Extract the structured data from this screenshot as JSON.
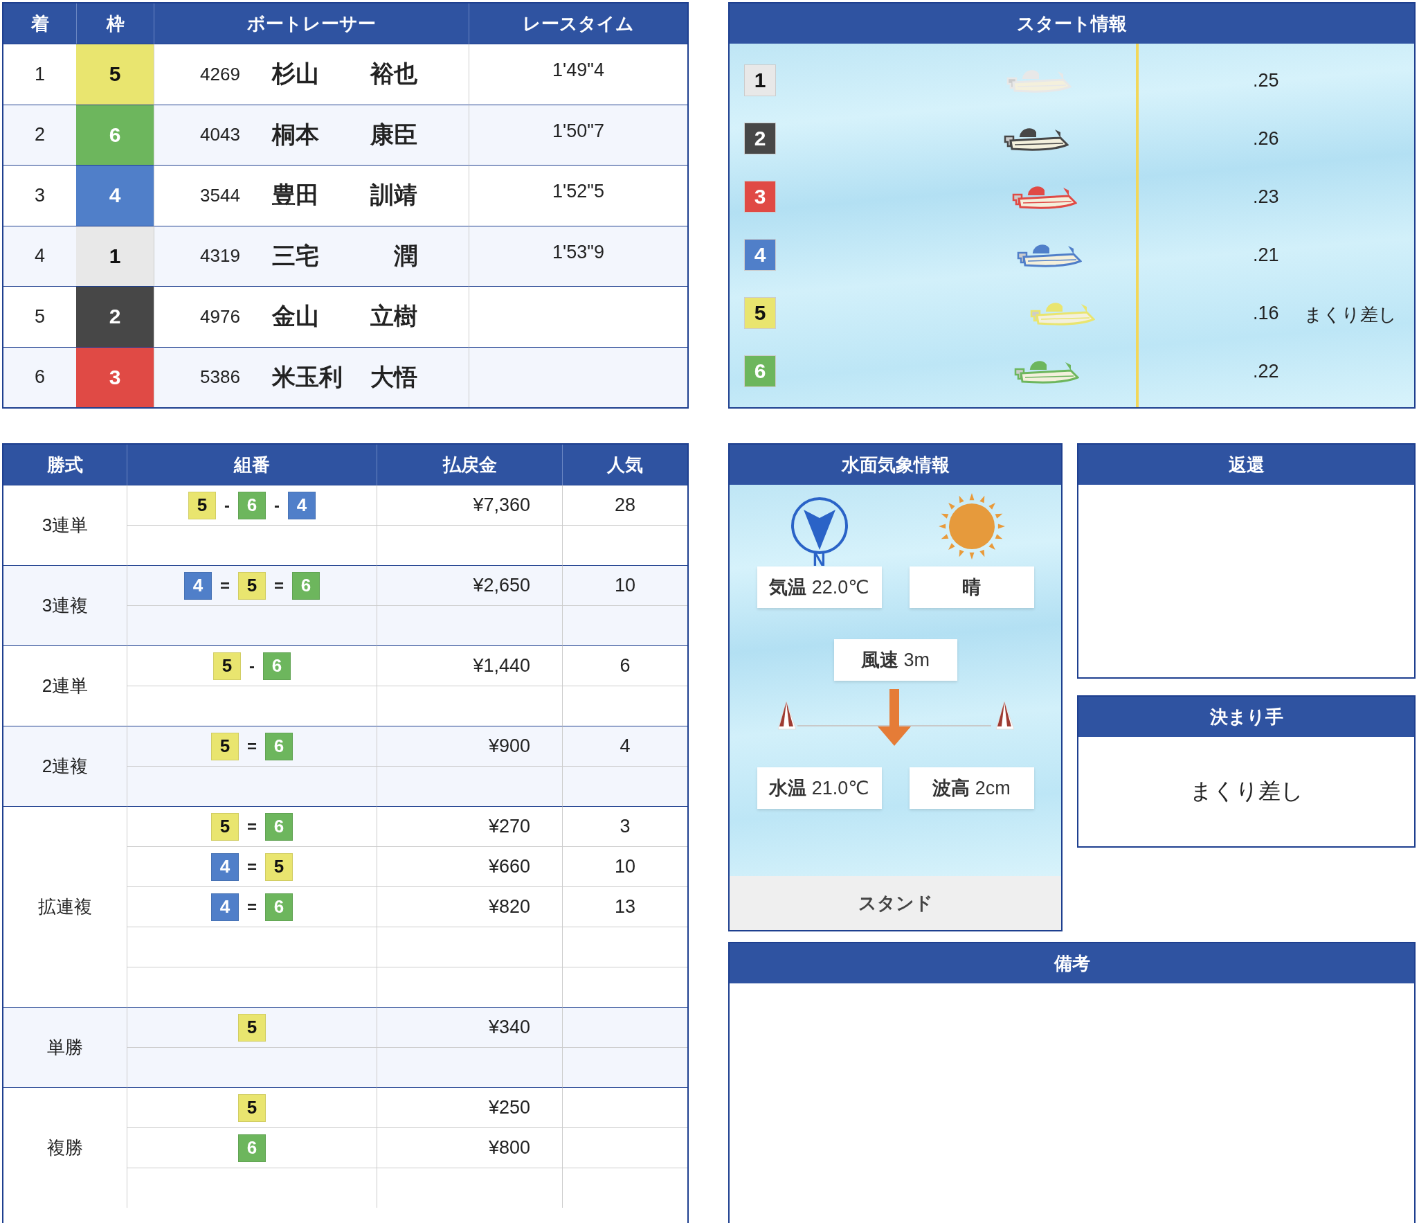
{
  "race_result": {
    "columns": [
      "着",
      "枠",
      "ボートレーサー",
      "レースタイム"
    ],
    "racers": [
      {
        "rank": "1",
        "frame": "5",
        "color": "#e9e56f",
        "reg_no": "4269",
        "surname": "杉山",
        "given_name": "裕也",
        "time": "1'49\"4"
      },
      {
        "rank": "2",
        "frame": "6",
        "color": "#6db65d",
        "reg_no": "4043",
        "surname": "桐本",
        "given_name": "康臣",
        "time": "1'50\"7"
      },
      {
        "rank": "3",
        "frame": "4",
        "color": "#507fc9",
        "reg_no": "3544",
        "surname": "豊田",
        "given_name": "訓靖",
        "time": "1'52\"5"
      },
      {
        "rank": "4",
        "frame": "1",
        "color": "#e8e8e8",
        "reg_no": "4319",
        "surname": "三宅",
        "given_name": "潤",
        "time": "1'53\"9"
      },
      {
        "rank": "5",
        "frame": "2",
        "color": "#474747",
        "reg_no": "4976",
        "surname": "金山",
        "given_name": "立樹"
      },
      {
        "rank": "6",
        "frame": "3",
        "color": "#e04a45",
        "reg_no": "5386",
        "surname": "米玉利",
        "given_name": "大悟"
      }
    ]
  },
  "start_info": {
    "title": "スタート情報",
    "entries": [
      {
        "frame": "1",
        "color": "#e8e8e8",
        "timing": ".25"
      },
      {
        "frame": "2",
        "color": "#474747",
        "timing": ".26"
      },
      {
        "frame": "3",
        "color": "#e04a45",
        "timing": ".23"
      },
      {
        "frame": "4",
        "color": "#507fc9",
        "timing": ".21"
      },
      {
        "frame": "5",
        "color": "#e9e56f",
        "timing": ".16",
        "technique": "まくり差し"
      },
      {
        "frame": "6",
        "color": "#6db65d",
        "timing": ".22"
      }
    ]
  },
  "payouts": {
    "columns": [
      "勝式",
      "組番",
      "払戻金",
      "人気"
    ],
    "groups": [
      {
        "bet_type": "3連単",
        "rows": [
          {
            "kind": "entry",
            "separator": "-",
            "combo": [
              {
                "num": "5",
                "color": "#e9e56f"
              },
              {
                "num": "6",
                "color": "#6db65d"
              },
              {
                "num": "4",
                "color": "#507fc9"
              }
            ],
            "payout": "¥7,360",
            "popularity": "28"
          },
          {
            "kind": "blank"
          }
        ]
      },
      {
        "bet_type": "3連複",
        "rows": [
          {
            "kind": "entry",
            "separator": "=",
            "combo": [
              {
                "num": "4",
                "color": "#507fc9"
              },
              {
                "num": "5",
                "color": "#e9e56f"
              },
              {
                "num": "6",
                "color": "#6db65d"
              }
            ],
            "payout": "¥2,650",
            "popularity": "10"
          },
          {
            "kind": "blank"
          }
        ]
      },
      {
        "bet_type": "2連単",
        "rows": [
          {
            "kind": "entry",
            "separator": "-",
            "combo": [
              {
                "num": "5",
                "color": "#e9e56f"
              },
              {
                "num": "6",
                "color": "#6db65d"
              }
            ],
            "payout": "¥1,440",
            "popularity": "6"
          },
          {
            "kind": "blank"
          }
        ]
      },
      {
        "bet_type": "2連複",
        "rows": [
          {
            "kind": "entry",
            "separator": "=",
            "combo": [
              {
                "num": "5",
                "color": "#e9e56f"
              },
              {
                "num": "6",
                "color": "#6db65d"
              }
            ],
            "payout": "¥900",
            "popularity": "4"
          },
          {
            "kind": "blank"
          }
        ]
      },
      {
        "bet_type": "拡連複",
        "rows": [
          {
            "kind": "entry",
            "separator": "=",
            "combo": [
              {
                "num": "5",
                "color": "#e9e56f"
              },
              {
                "num": "6",
                "color": "#6db65d"
              }
            ],
            "payout": "¥270",
            "popularity": "3"
          },
          {
            "kind": "entry",
            "separator": "=",
            "combo": [
              {
                "num": "4",
                "color": "#507fc9"
              },
              {
                "num": "5",
                "color": "#e9e56f"
              }
            ],
            "payout": "¥660",
            "popularity": "10"
          },
          {
            "kind": "entry",
            "separator": "=",
            "combo": [
              {
                "num": "4",
                "color": "#507fc9"
              },
              {
                "num": "6",
                "color": "#6db65d"
              }
            ],
            "payout": "¥820",
            "popularity": "13"
          },
          {
            "kind": "blank"
          },
          {
            "kind": "blank"
          }
        ]
      },
      {
        "bet_type": "単勝",
        "rows": [
          {
            "kind": "entry",
            "combo": [
              {
                "num": "5",
                "color": "#e9e56f"
              }
            ],
            "payout": "¥340"
          },
          {
            "kind": "blank"
          }
        ]
      },
      {
        "bet_type": "複勝",
        "rows": [
          {
            "kind": "entry",
            "combo": [
              {
                "num": "5",
                "color": "#e9e56f"
              }
            ],
            "payout": "¥250"
          },
          {
            "kind": "entry",
            "combo": [
              {
                "num": "6",
                "color": "#6db65d"
              }
            ],
            "payout": "¥800"
          },
          {
            "kind": "blank"
          }
        ]
      }
    ]
  },
  "weather": {
    "title": "水面気象情報",
    "compass_label": "N",
    "air_temp": "**気温** 22.0℃",
    "condition": "晴",
    "wind": "**風速** 3m",
    "water_temp": "**水温** 21.0℃",
    "wave": "**波高** 2cm",
    "footer": "スタンド"
  },
  "refund": {
    "title": "返還"
  },
  "winning_technique": {
    "title": "決まり手",
    "value": "まくり差し"
  },
  "notes": {
    "title": "備考"
  }
}
